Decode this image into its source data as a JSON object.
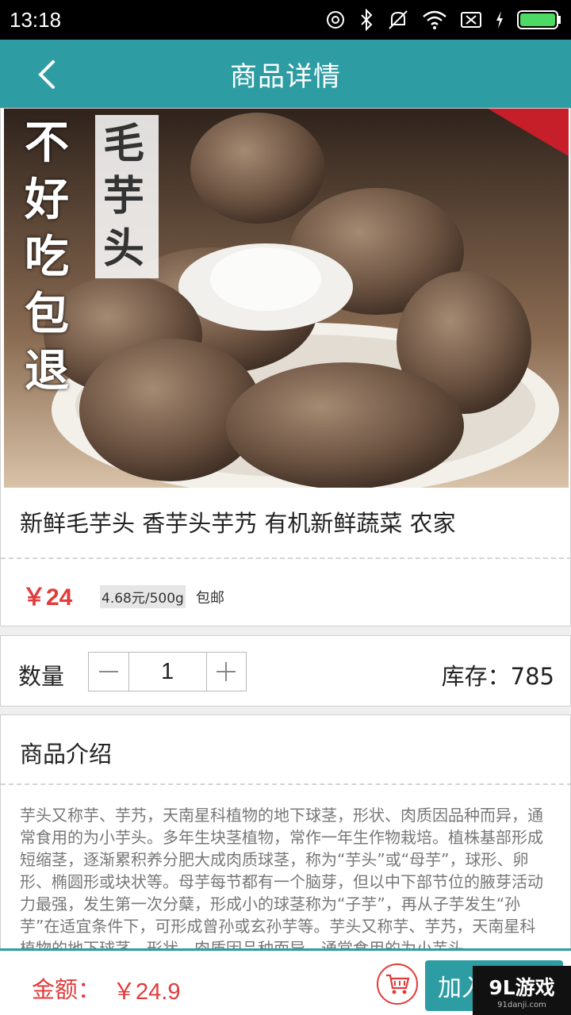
{
  "status_bar": {
    "time": "13:18"
  },
  "app_bar": {
    "title": "商品详情"
  },
  "product": {
    "image_text_left": "不好吃包退",
    "image_text_right": "毛芋头",
    "name": "新鲜毛芋头 香芋头芋艿 有机新鲜蔬菜 农家",
    "price": "￥24",
    "unit_price": "4.68元/500g",
    "shipping": "包邮"
  },
  "quantity": {
    "label": "数量",
    "value": "1",
    "stock_label": "库存：785"
  },
  "description": {
    "title": "商品介绍",
    "text": "芋头又称芋、芋艿，天南星科植物的地下球茎，形状、肉质因品种而异，通常食用的为小芋头。多年生块茎植物，常作一年生作物栽培。植株基部形成短缩茎，逐渐累积养分肥大成肉质球茎，称为“芋头”或“母芋”，球形、卵形、椭圆形或块状等。母芋每节都有一个脑芽，但以中下部节位的腋芽活动力最强，发生第一次分蘖，形成小的球茎称为“子芋”，再从子芋发生“孙芋”在适宜条件下，可形成曾孙或玄孙芋等。芋头又称芋、芋艿，天南星科植物的地下球茎，形状、肉质因品种而异，通常食用的为小芋头。"
  },
  "bottom_bar": {
    "total_label": "金额：",
    "total_value": "￥24.9",
    "add_button": "加入购物车"
  },
  "watermark": {
    "main": "9L游戏",
    "sub": "91danji.com"
  },
  "colors": {
    "primary": "#2e9da3",
    "accent_red": "#e23b3b"
  }
}
